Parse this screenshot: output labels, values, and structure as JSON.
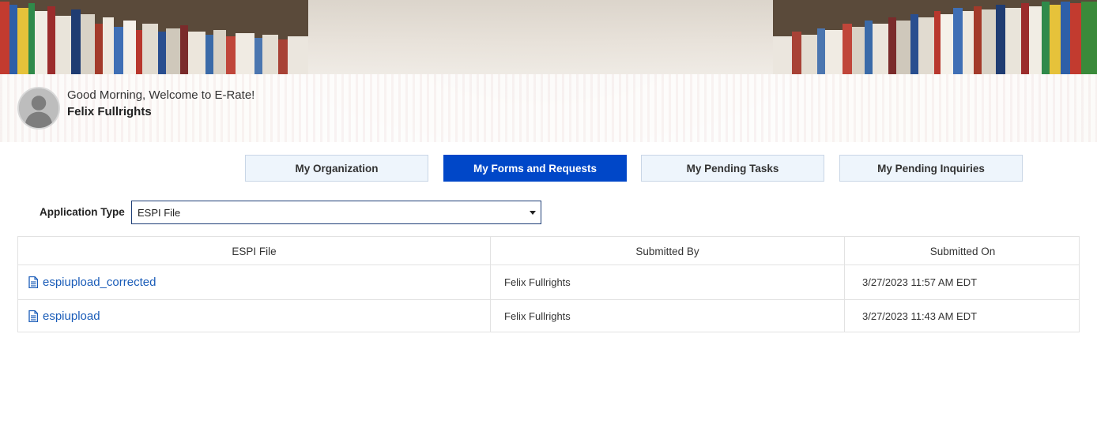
{
  "header": {
    "greeting": "Good Morning, Welcome to E-Rate!",
    "user_name": "Felix Fullrights"
  },
  "tabs": [
    {
      "label": "My Organization",
      "active": false
    },
    {
      "label": "My Forms and Requests",
      "active": true
    },
    {
      "label": "My Pending Tasks",
      "active": false
    },
    {
      "label": "My Pending Inquiries",
      "active": false
    }
  ],
  "filter": {
    "label": "Application Type",
    "selected": "ESPI File"
  },
  "table": {
    "columns": [
      "ESPI File",
      "Submitted By",
      "Submitted On"
    ],
    "rows": [
      {
        "file": "espiupload_corrected",
        "submitted_by": "Felix Fullrights",
        "submitted_on": "3/27/2023 11:57 AM EDT"
      },
      {
        "file": "espiupload",
        "submitted_by": "Felix Fullrights",
        "submitted_on": "3/27/2023 11:43 AM EDT"
      }
    ]
  },
  "colors": {
    "accent": "#0047c8",
    "tab_inactive_bg": "#eef5fc",
    "link": "#1a5cb8",
    "select_border": "#1f3f77"
  },
  "icons": {
    "avatar": "user-silhouette-icon",
    "file": "document-icon",
    "dropdown": "caret-down-icon"
  }
}
